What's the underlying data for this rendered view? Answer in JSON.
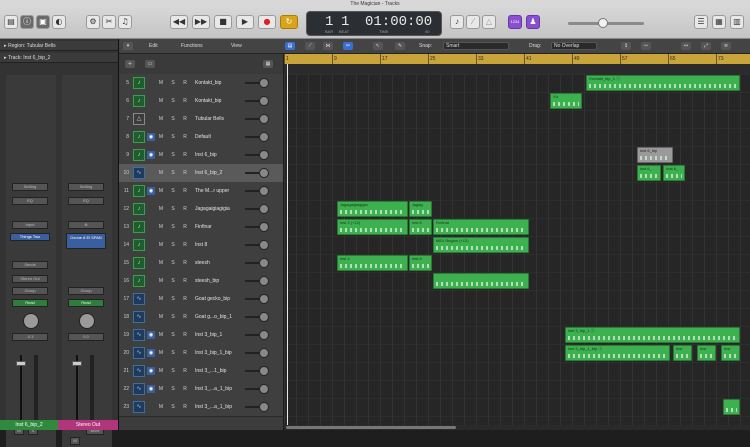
{
  "window": {
    "title": "The Magician - Tracks"
  },
  "lcd": {
    "bar": "1",
    "beat": "1",
    "time": "01:00:00",
    "sub_bar": "BAR",
    "sub_beat": "BEAT",
    "sub_time": "TIME",
    "tempo_label": "00"
  },
  "toolbar": {
    "count_in_label": "1234",
    "tuner_label": "♪"
  },
  "inspector": {
    "region": "Region: Tubular Bells",
    "track": "Track: Inst 6_bip_2",
    "strip1": {
      "setting": "Setting",
      "eq": "EQ",
      "input": "Input",
      "instrument": "Things Two",
      "sends": "Sends",
      "output": "Stereo Out",
      "group": "Group",
      "automation": "Read",
      "pan": "-0.3",
      "name": "Inst 6_bip_2",
      "m": "M",
      "s": "S"
    },
    "strip2": {
      "setting": "Setting",
      "eq": "EQ",
      "input": "⊗",
      "instrument": "Ozone 8 El SPAN",
      "output": "",
      "group": "Group",
      "automation": "Read",
      "pan": "0.0",
      "bnce": "Bnce",
      "name": "Stereo Out",
      "m": "M"
    }
  },
  "tracks_toolbar": {
    "edit": "Edit",
    "functions": "Functions",
    "view": "View",
    "snap_label": "Snap:",
    "snap_value": "Smart",
    "drag_label": "Drag:",
    "drag_value": "No Overlap"
  },
  "ruler": {
    "ticks": [
      "1",
      "9",
      "17",
      "25",
      "33",
      "41",
      "49",
      "57",
      "65",
      "73"
    ]
  },
  "tracks": [
    {
      "num": "5",
      "name": "Kontakt_bip",
      "kind": "midi",
      "m": "M",
      "s": "S",
      "r": "R",
      "mon": false,
      "sel": false
    },
    {
      "num": "6",
      "name": "Kontakt_bip",
      "kind": "midi",
      "m": "M",
      "s": "S",
      "r": "R",
      "mon": false,
      "sel": false
    },
    {
      "num": "7",
      "name": "Tubular Bells",
      "kind": "drum",
      "m": "M",
      "s": "S",
      "r": "R",
      "mon": false,
      "sel": false
    },
    {
      "num": "8",
      "name": "Default",
      "kind": "midi",
      "m": "M",
      "s": "S",
      "r": "R",
      "mon": true,
      "sel": false
    },
    {
      "num": "9",
      "name": "Inst 6_bip",
      "kind": "midi",
      "m": "M",
      "s": "S",
      "r": "R",
      "mon": true,
      "sel": false
    },
    {
      "num": "10",
      "name": "Inst 6_bip_2",
      "kind": "audio",
      "m": "M",
      "s": "S",
      "r": "R",
      "mon": false,
      "sel": true
    },
    {
      "num": "11",
      "name": "The M...r upper",
      "kind": "midi",
      "m": "M",
      "s": "S",
      "r": "R",
      "mon": true,
      "sel": false
    },
    {
      "num": "12",
      "name": "Jagagaigiagigia",
      "kind": "midi",
      "m": "M",
      "s": "S",
      "r": "R",
      "mon": false,
      "sel": false
    },
    {
      "num": "13",
      "name": "Finfinar",
      "kind": "midi",
      "m": "M",
      "s": "S",
      "r": "R",
      "mon": false,
      "sel": false
    },
    {
      "num": "14",
      "name": "Inst 8",
      "kind": "midi",
      "m": "M",
      "s": "S",
      "r": "R",
      "mon": false,
      "sel": false
    },
    {
      "num": "15",
      "name": "steesh",
      "kind": "midi",
      "m": "M",
      "s": "S",
      "r": "R",
      "mon": false,
      "sel": false
    },
    {
      "num": "16",
      "name": "steesh_bip",
      "kind": "midi",
      "m": "M",
      "s": "S",
      "r": "R",
      "mon": false,
      "sel": false
    },
    {
      "num": "17",
      "name": "Goat gecko_bip",
      "kind": "audio",
      "m": "M",
      "s": "S",
      "r": "R",
      "mon": false,
      "sel": false
    },
    {
      "num": "18",
      "name": "Goat g...o_bip_1",
      "kind": "audio",
      "m": "M",
      "s": "S",
      "r": "R",
      "mon": false,
      "sel": false
    },
    {
      "num": "19",
      "name": "Inst 3_bip_1",
      "kind": "audio",
      "m": "M",
      "s": "S",
      "r": "R",
      "mon": true,
      "sel": false
    },
    {
      "num": "20",
      "name": "Inst 3_bip_1_bip",
      "kind": "audio",
      "m": "M",
      "s": "S",
      "r": "R",
      "mon": true,
      "sel": false
    },
    {
      "num": "21",
      "name": "Inst 3_...1_bip",
      "kind": "audio",
      "m": "M",
      "s": "S",
      "r": "R",
      "mon": true,
      "sel": false
    },
    {
      "num": "22",
      "name": "Inst 3_...a_1_bip",
      "kind": "audio",
      "m": "M",
      "s": "S",
      "r": "R",
      "mon": true,
      "sel": false
    },
    {
      "num": "23",
      "name": "Inst 3_...a_1_bip",
      "kind": "audio",
      "m": "M",
      "s": "S",
      "r": "R",
      "mon": false,
      "sel": false
    }
  ],
  "regions": [
    {
      "name": "Kontakt_bip_1 ⓘ",
      "row": 0,
      "start": 25.2,
      "end": 38
    },
    {
      "name": "Ko",
      "row": 1,
      "start": 22.2,
      "end": 24.8
    },
    {
      "name": "Inst 6_bip",
      "row": 4,
      "start": 29.4,
      "end": 32.4,
      "pale": true
    },
    {
      "name": "Inst 6_",
      "row": 5,
      "start": 29.4,
      "end": 31.4
    },
    {
      "name": "Inst 6_",
      "row": 5,
      "start": 31.6,
      "end": 33.4
    },
    {
      "name": "Jagagaigiagigia",
      "row": 7,
      "start": 4.4,
      "end": 10.3
    },
    {
      "name": "Jagag",
      "row": 7,
      "start": 10.4,
      "end": 12.3
    },
    {
      "name": "Inst 3 (+12)",
      "row": 8,
      "start": 4.4,
      "end": 10.3
    },
    {
      "name": "Inst 8",
      "row": 8,
      "start": 10.4,
      "end": 12.3
    },
    {
      "name": "Finfinar",
      "row": 8,
      "start": 12.4,
      "end": 20.4
    },
    {
      "name": "MIDI Region (+12)",
      "row": 9,
      "start": 12.4,
      "end": 20.4
    },
    {
      "name": "Inst 4",
      "row": 10,
      "start": 4.4,
      "end": 10.3
    },
    {
      "name": "Inst 8",
      "row": 10,
      "start": 10.4,
      "end": 12.3
    },
    {
      "name": "",
      "row": 11,
      "start": 12.4,
      "end": 20.4
    },
    {
      "name": "Inst 3_bip_1 ⓘ",
      "row": 14,
      "start": 23.4,
      "end": 38
    },
    {
      "name": "Inst 3_bip_1_bip ⓘ",
      "row": 15,
      "start": 23.4,
      "end": 32.2
    },
    {
      "name": "Inst",
      "row": 15,
      "start": 32.4,
      "end": 34
    },
    {
      "name": "Inst",
      "row": 15,
      "start": 34.4,
      "end": 36
    },
    {
      "name": "Inst",
      "row": 15,
      "start": 36.4,
      "end": 38
    },
    {
      "name": "",
      "row": 18,
      "start": 36.6,
      "end": 38
    }
  ]
}
